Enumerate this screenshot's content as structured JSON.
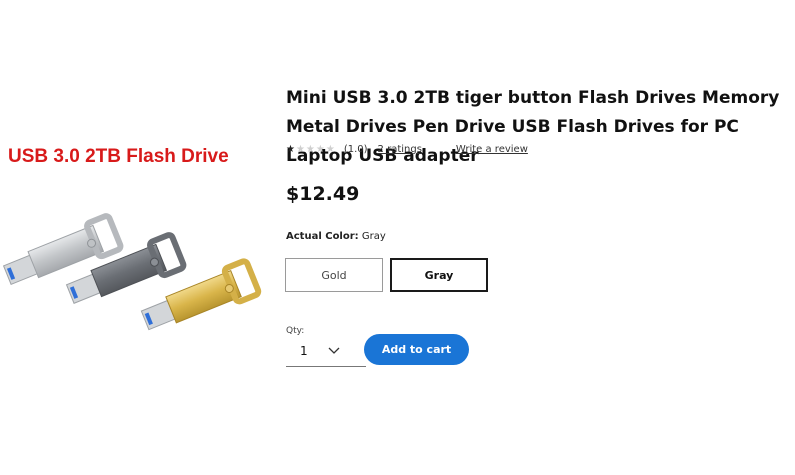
{
  "promo": {
    "label": "USB 3.0 2TB Flash Drive"
  },
  "product": {
    "title": "Mini USB 3.0 2TB tiger button Flash Drives Memory Metal Drives Pen Drive USB Flash Drives for PC Laptop USB adapter",
    "rating_value": 1.0,
    "rating_text": "(1.0)",
    "ratings_link": "2 ratings",
    "review_link": "Write a review",
    "price": "$12.49",
    "image_icon": "usb-flash-drive-icon"
  },
  "color": {
    "label": "Actual Color:",
    "selected": "Gray",
    "options": [
      "Gold",
      "Gray"
    ]
  },
  "quantity": {
    "caption": "Qty:",
    "value": "1"
  },
  "cart": {
    "button_label": "Add to cart"
  },
  "colors": {
    "promo_red": "#d81a1a",
    "button_blue": "#1a75d6",
    "gold": "#d9b54a",
    "gray_drive": "#6f7379",
    "silver": "#cfd2d4"
  }
}
